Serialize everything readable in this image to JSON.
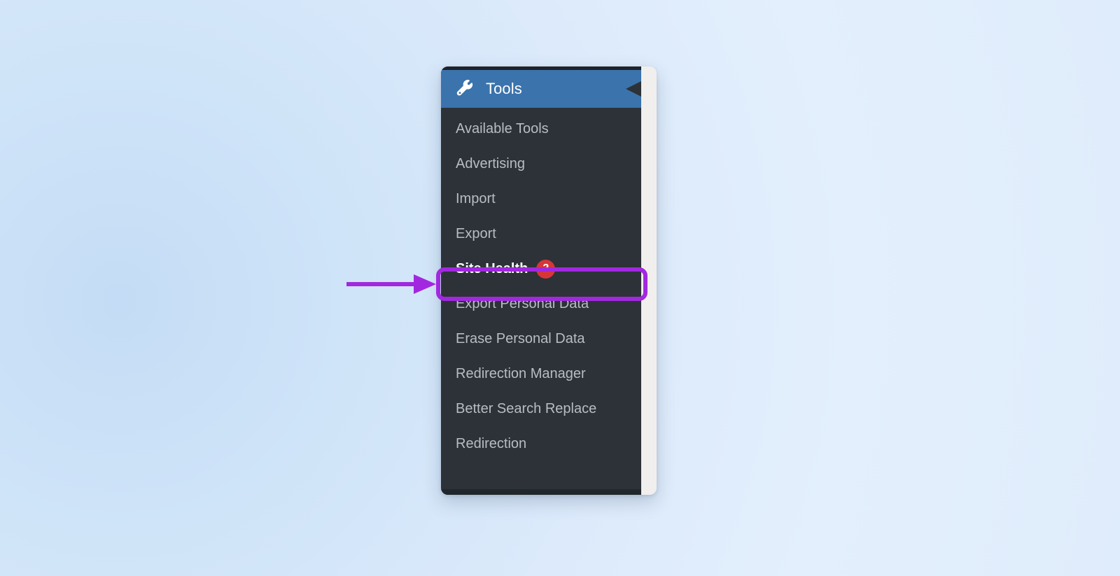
{
  "menu": {
    "header": {
      "title": "Tools",
      "icon": "wrench-icon",
      "background_color": "#3b73ad"
    },
    "panel_color": "#2c3238",
    "flyout_color": "#f0efed",
    "items": [
      {
        "label": "Available Tools",
        "current": false,
        "badge": null
      },
      {
        "label": "Advertising",
        "current": false,
        "badge": null
      },
      {
        "label": "Import",
        "current": false,
        "badge": null
      },
      {
        "label": "Export",
        "current": false,
        "badge": null
      },
      {
        "label": "Site Health",
        "current": true,
        "badge": "2"
      },
      {
        "label": "Export Personal Data",
        "current": false,
        "badge": null
      },
      {
        "label": "Erase Personal Data",
        "current": false,
        "badge": null
      },
      {
        "label": "Redirection Manager",
        "current": false,
        "badge": null
      },
      {
        "label": "Better Search Replace",
        "current": false,
        "badge": null
      },
      {
        "label": "Redirection",
        "current": false,
        "badge": null
      }
    ]
  },
  "annotation": {
    "color": "#a228e0",
    "badge_color": "#d63638",
    "target_label": "Site Health"
  },
  "background": {
    "color": "#dcebfb"
  }
}
